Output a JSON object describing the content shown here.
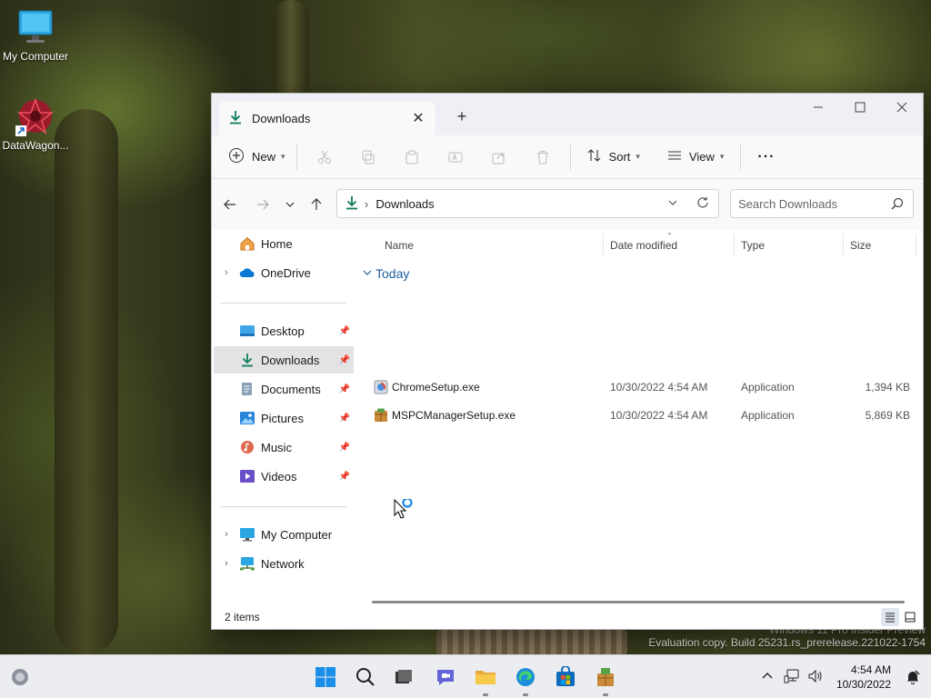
{
  "desktop": {
    "icons": [
      {
        "label": "My Computer"
      },
      {
        "label": "DataWagon..."
      }
    ],
    "watermark_line1": "Windows 11 Pro Insider Preview",
    "watermark_line2": "Evaluation copy. Build 25231.rs_prerelease.221022-1754"
  },
  "window": {
    "tab_title": "Downloads",
    "toolbar": {
      "new_label": "New",
      "sort_label": "Sort",
      "view_label": "View",
      "more_label": "···"
    },
    "address": {
      "path_label": "Downloads",
      "search_placeholder": "Search Downloads"
    },
    "nav": {
      "home": "Home",
      "onedrive": "OneDrive",
      "desktop": "Desktop",
      "downloads": "Downloads",
      "documents": "Documents",
      "pictures": "Pictures",
      "music": "Music",
      "videos": "Videos",
      "mycomputer": "My Computer",
      "network": "Network"
    },
    "columns": {
      "name": "Name",
      "date": "Date modified",
      "type": "Type",
      "size": "Size"
    },
    "group": "Today",
    "files": [
      {
        "name": "ChromeSetup.exe",
        "date": "10/30/2022 4:54 AM",
        "type": "Application",
        "size": "1,394 KB"
      },
      {
        "name": "MSPCManagerSetup.exe",
        "date": "10/30/2022 4:54 AM",
        "type": "Application",
        "size": "5,869 KB"
      }
    ],
    "status": "2 items"
  },
  "taskbar": {
    "time": "4:54 AM",
    "date": "10/30/2022"
  },
  "colors": {
    "accent": "#0f7b5f",
    "folder": "#f2c14b",
    "link": "#1f5f9e"
  }
}
